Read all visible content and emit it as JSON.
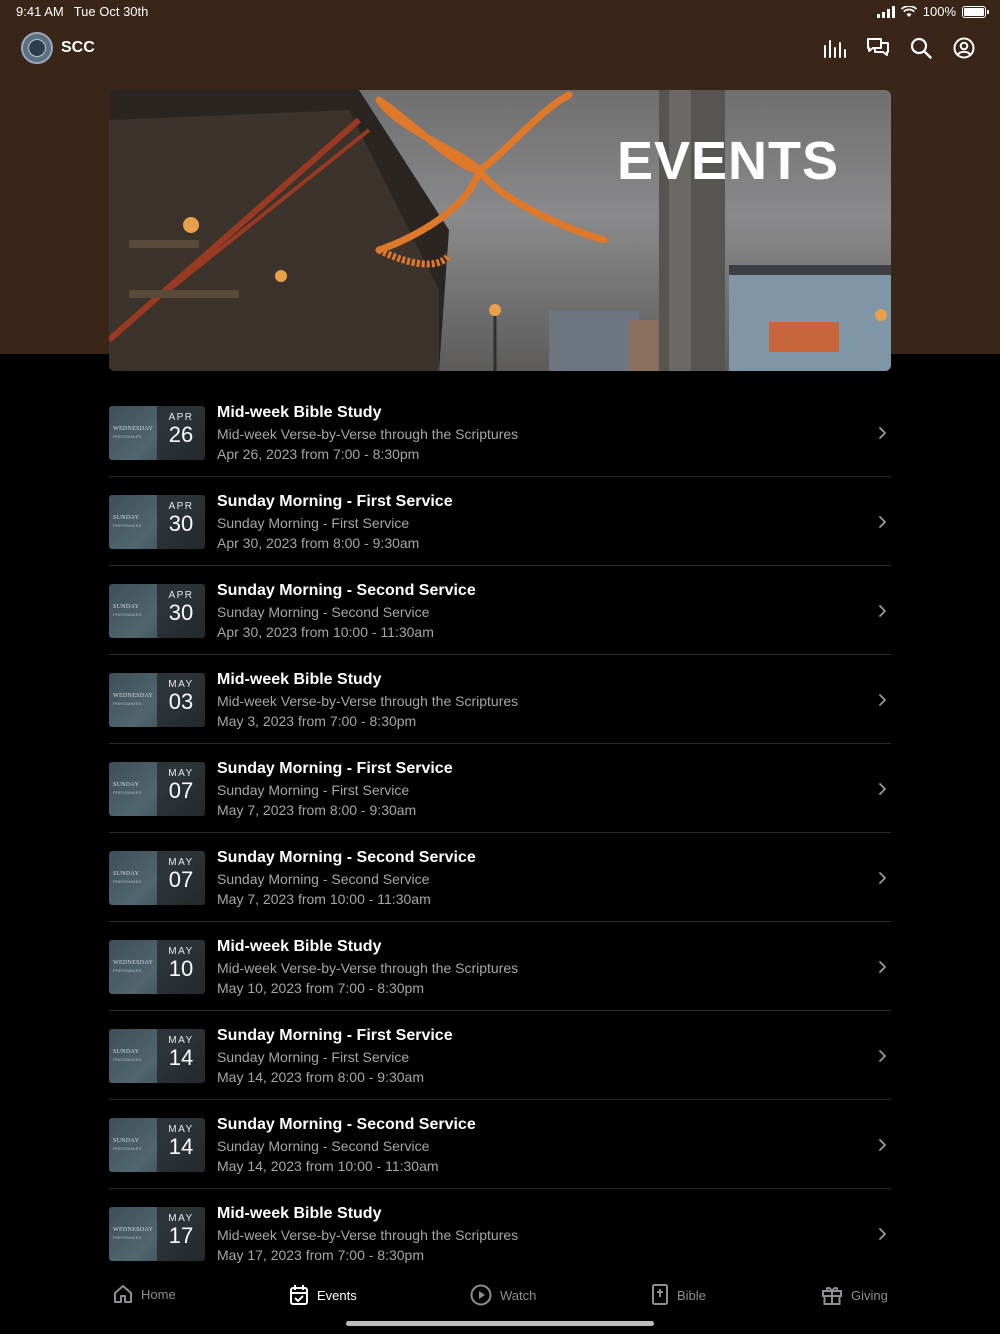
{
  "status_bar": {
    "time": "9:41 AM",
    "date": "Tue Oct 30th",
    "battery": "100%"
  },
  "header": {
    "app_title": "SCC",
    "icons": [
      "audio-bars-icon",
      "chat-icon",
      "search-icon",
      "account-icon"
    ]
  },
  "hero": {
    "title": "EVENTS"
  },
  "events": [
    {
      "month": "APR",
      "day": "26",
      "title": "Mid-week Bible Study",
      "subtitle": "Mid-week Verse-by-Verse through the Scriptures",
      "when": "Apr 26, 2023 from 7:00 - 8:30pm",
      "thumb": "WEDNESDAY",
      "thumb_sub": "PRESSANIES"
    },
    {
      "month": "APR",
      "day": "30",
      "title": "Sunday Morning - First Service",
      "subtitle": "Sunday Morning - First Service",
      "when": "Apr 30, 2023 from 8:00 - 9:30am",
      "thumb": "SUNDAY",
      "thumb_sub": "PRESSANIES"
    },
    {
      "month": "APR",
      "day": "30",
      "title": "Sunday Morning - Second Service",
      "subtitle": "Sunday Morning - Second Service",
      "when": "Apr 30, 2023 from 10:00 - 11:30am",
      "thumb": "SUNDAY",
      "thumb_sub": "PRESSANIES"
    },
    {
      "month": "MAY",
      "day": "03",
      "title": "Mid-week Bible Study",
      "subtitle": "Mid-week Verse-by-Verse through the Scriptures",
      "when": "May 3, 2023 from 7:00 - 8:30pm",
      "thumb": "WEDNESDAY",
      "thumb_sub": "PRESSANIES"
    },
    {
      "month": "MAY",
      "day": "07",
      "title": "Sunday Morning - First Service",
      "subtitle": "Sunday Morning - First Service",
      "when": "May 7, 2023 from 8:00 - 9:30am",
      "thumb": "SUNDAY",
      "thumb_sub": "PRESSANIES"
    },
    {
      "month": "MAY",
      "day": "07",
      "title": "Sunday Morning - Second Service",
      "subtitle": "Sunday Morning - Second Service",
      "when": "May 7, 2023 from 10:00 - 11:30am",
      "thumb": "SUNDAY",
      "thumb_sub": "PRESSANIES"
    },
    {
      "month": "MAY",
      "day": "10",
      "title": "Mid-week Bible Study",
      "subtitle": "Mid-week Verse-by-Verse through the Scriptures",
      "when": "May 10, 2023 from 7:00 - 8:30pm",
      "thumb": "WEDNESDAY",
      "thumb_sub": "PRESSANIES"
    },
    {
      "month": "MAY",
      "day": "14",
      "title": "Sunday Morning - First Service",
      "subtitle": "Sunday Morning - First Service",
      "when": "May 14, 2023 from 8:00 - 9:30am",
      "thumb": "SUNDAY",
      "thumb_sub": "PRESSANIES"
    },
    {
      "month": "MAY",
      "day": "14",
      "title": "Sunday Morning - Second Service",
      "subtitle": "Sunday Morning - Second Service",
      "when": "May 14, 2023 from 10:00 - 11:30am",
      "thumb": "SUNDAY",
      "thumb_sub": "PRESSANIES"
    },
    {
      "month": "MAY",
      "day": "17",
      "title": "Mid-week Bible Study",
      "subtitle": "Mid-week Verse-by-Verse through the Scriptures",
      "when": "May 17, 2023 from 7:00 - 8:30pm",
      "thumb": "WEDNESDAY",
      "thumb_sub": "PRESSANIES"
    }
  ],
  "tabs": [
    {
      "label": "Home",
      "icon": "home-icon",
      "active": false
    },
    {
      "label": "Events",
      "icon": "calendar-icon",
      "active": true
    },
    {
      "label": "Watch",
      "icon": "play-icon",
      "active": false
    },
    {
      "label": "Bible",
      "icon": "bible-icon",
      "active": false
    },
    {
      "label": "Giving",
      "icon": "gift-icon",
      "active": false
    }
  ],
  "colors": {
    "header_bg": "#3a2618",
    "background": "#000000",
    "accent_orange": "#e0782a"
  }
}
